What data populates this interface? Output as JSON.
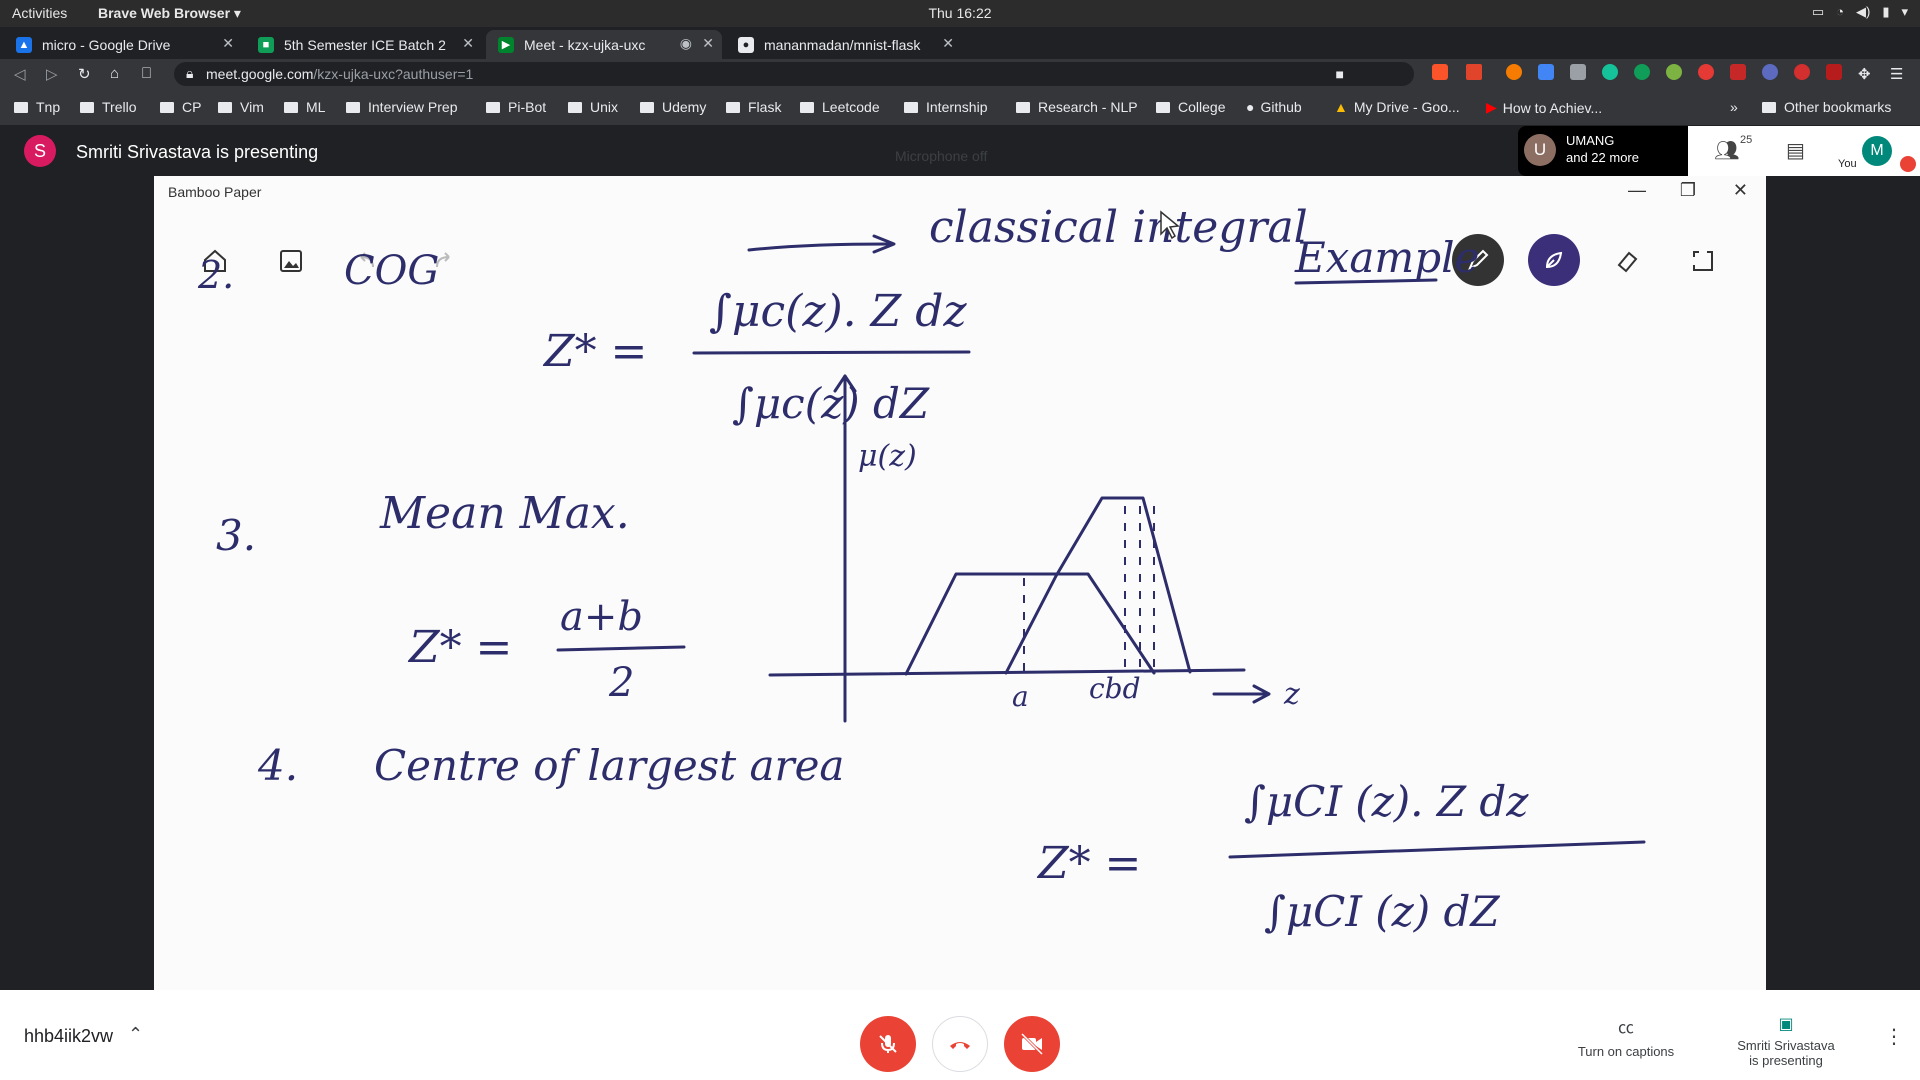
{
  "system": {
    "activities": "Activities",
    "app_menu": "Brave Web Browser ▾",
    "clock": "Thu 16:22"
  },
  "tabs": [
    {
      "label": "micro - Google Drive",
      "favicon_color": "#1a73e8"
    },
    {
      "label": "5th Semester ICE Batch 2",
      "favicon_color": "#0f9d58"
    },
    {
      "label": "Meet - kzx-ujka-uxc",
      "favicon_color": "#00832d"
    },
    {
      "label": "mananmadan/mnist-flask",
      "favicon_color": "#e8eaed"
    }
  ],
  "address_bar": {
    "domain": "meet.google.com",
    "path": "/kzx-ujka-uxc?authuser=1"
  },
  "bookmarks": [
    {
      "label": "Tnp"
    },
    {
      "label": "Trello"
    },
    {
      "label": "CP"
    },
    {
      "label": "Vim"
    },
    {
      "label": "ML"
    },
    {
      "label": "Interview Prep"
    },
    {
      "label": "Pi-Bot"
    },
    {
      "label": "Unix"
    },
    {
      "label": "Udemy"
    },
    {
      "label": "Flask"
    },
    {
      "label": "Leetcode"
    },
    {
      "label": "Internship"
    },
    {
      "label": "Research - NLP"
    },
    {
      "label": "College"
    },
    {
      "label": "Github"
    },
    {
      "label": "My Drive - Goo..."
    },
    {
      "label": "How to Achiev..."
    }
  ],
  "bookmarks_overflow": "»",
  "other_bookmarks": "Other bookmarks",
  "meet": {
    "presenter_initial": "S",
    "presenter_text": "Smriti Srivastava is presenting",
    "mic_status": "Microphone off",
    "participant_initial": "U",
    "participant_name": "UMANG",
    "participant_more": "and 22 more",
    "participant_count": "25",
    "you_label": "You",
    "my_initial": "M",
    "meeting_code": "hhb4iik2vw",
    "captions_label": "Turn on captions",
    "presenting_label_1": "Smriti Srivastava",
    "presenting_label_2": "is presenting"
  },
  "bamboo": {
    "title": "Bamboo Paper"
  },
  "whiteboard": {
    "header_arrow_text": "classical integral",
    "example_label": "Example",
    "item2_number": "2.",
    "item2_label": "COG",
    "item2_lhs": "Z* =",
    "item2_numerator": "∫μc(z). Z dz",
    "item2_denominator": "∫μc(z) dZ",
    "graph_ylabel": "μ(z)",
    "graph_xlabel": "z",
    "graph_tick_a": "a",
    "graph_tick_cbd": "cbd",
    "item3_number": "3.",
    "item3_label": "Mean Max.",
    "item3_lhs": "Z* =",
    "item3_numerator": "a+b",
    "item3_denominator": "2",
    "item4_number": "4.",
    "item4_label": "Centre of largest area",
    "item4_lhs": "Z* =",
    "item4_numerator": "∫μCI (z). Z dz",
    "item4_denominator": "∫μCI (z) dZ"
  },
  "colors": {
    "ink": "#2d2d6b",
    "meet_red": "#ea4335",
    "pen_dark": "#333333",
    "pen_active": "#3b2f7a"
  }
}
